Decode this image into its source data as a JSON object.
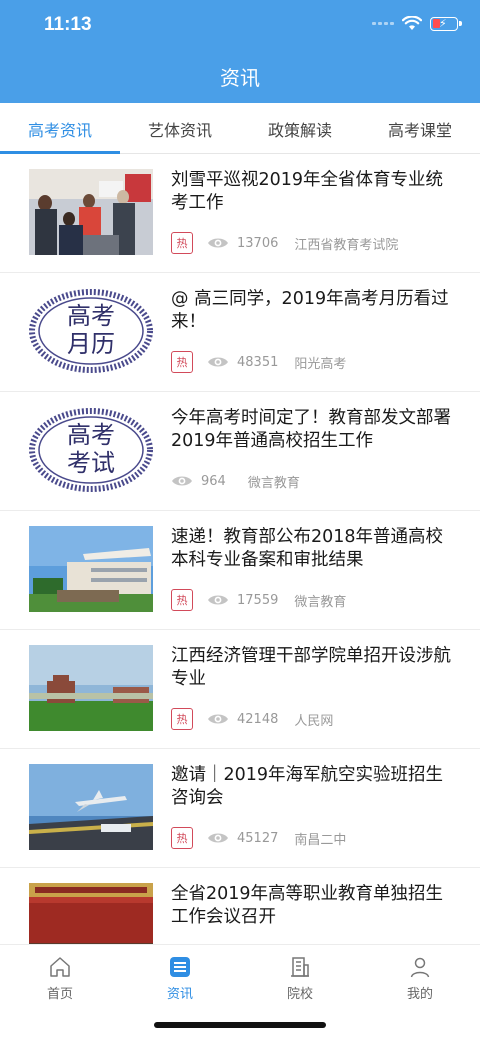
{
  "status_bar": {
    "time": "11:13"
  },
  "header": {
    "title": "资讯"
  },
  "tabs": [
    {
      "label": "高考资讯",
      "active": true
    },
    {
      "label": "艺体资讯",
      "active": false
    },
    {
      "label": "政策解读",
      "active": false
    },
    {
      "label": "高考课堂",
      "active": false
    }
  ],
  "articles": [
    {
      "title": "刘雪平巡视2019年全省体育专业统考工作",
      "hot_label": "热",
      "views": "13706",
      "source": "江西省教育考试院"
    },
    {
      "title": "@ 高三同学，2019年高考月历看过来！",
      "hot_label": "热",
      "views": "48351",
      "source": "阳光高考",
      "thumb_text": "高考月历"
    },
    {
      "title": "今年高考时间定了！教育部发文部署2019年普通高校招生工作",
      "views": "964",
      "source": "微言教育",
      "thumb_text": "高考考试"
    },
    {
      "title": "速递！教育部公布2018年普通高校本科专业备案和审批结果",
      "hot_label": "热",
      "views": "17559",
      "source": "微言教育"
    },
    {
      "title": "江西经济管理干部学院单招开设涉航专业",
      "hot_label": "热",
      "views": "42148",
      "source": "人民网"
    },
    {
      "title": "邀请｜2019年海军航空实验班招生咨询会",
      "hot_label": "热",
      "views": "45127",
      "source": "南昌二中"
    },
    {
      "title": "全省2019年高等职业教育单独招生工作会议召开"
    }
  ],
  "tab_bar": [
    {
      "label": "首页",
      "icon": "home-icon",
      "active": false
    },
    {
      "label": "资讯",
      "icon": "news-icon",
      "active": true
    },
    {
      "label": "院校",
      "icon": "building-icon",
      "active": false
    },
    {
      "label": "我的",
      "icon": "profile-icon",
      "active": false
    }
  ],
  "colors": {
    "accent": "#2f8ee3",
    "header": "#4a9fe8",
    "hot": "#d24a5a"
  }
}
